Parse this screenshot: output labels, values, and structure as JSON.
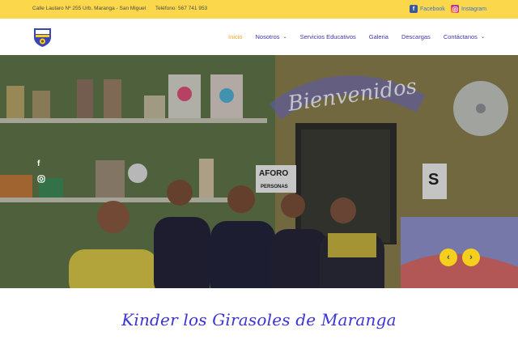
{
  "topbar": {
    "address": "Calle Lautaro Nº 255 Urb. Maranga - San Miguel",
    "phone": "Teléfono: 567 741 953",
    "facebook_label": "Facebook",
    "instagram_label": "Instagram"
  },
  "nav": {
    "items": [
      {
        "label": "Inicio",
        "active": true,
        "dropdown": false
      },
      {
        "label": "Nosotros",
        "active": false,
        "dropdown": true
      },
      {
        "label": "Servicios Educativos",
        "active": false,
        "dropdown": false
      },
      {
        "label": "Galeria",
        "active": false,
        "dropdown": false
      },
      {
        "label": "Descargas",
        "active": false,
        "dropdown": false
      },
      {
        "label": "Contáctanos",
        "active": false,
        "dropdown": true
      }
    ]
  },
  "hero": {
    "banner_text": "Bienvenidos",
    "sign_aforo": "AFORO",
    "sign_personas": "PERSONAS",
    "sign_s": "S",
    "slider_prev": "‹",
    "slider_next": "›"
  },
  "main": {
    "title": "Kinder los Girasoles de Maranga"
  },
  "colors": {
    "topbar_bg": "#fbd84b",
    "nav_text": "#3f37a6",
    "nav_active": "#f2a62b",
    "title_color": "#3b34d2",
    "arrow_bg": "#f4d01c"
  },
  "icons": {
    "facebook": "facebook-icon",
    "instagram": "instagram-icon",
    "chevron": "chevron-down-icon"
  }
}
